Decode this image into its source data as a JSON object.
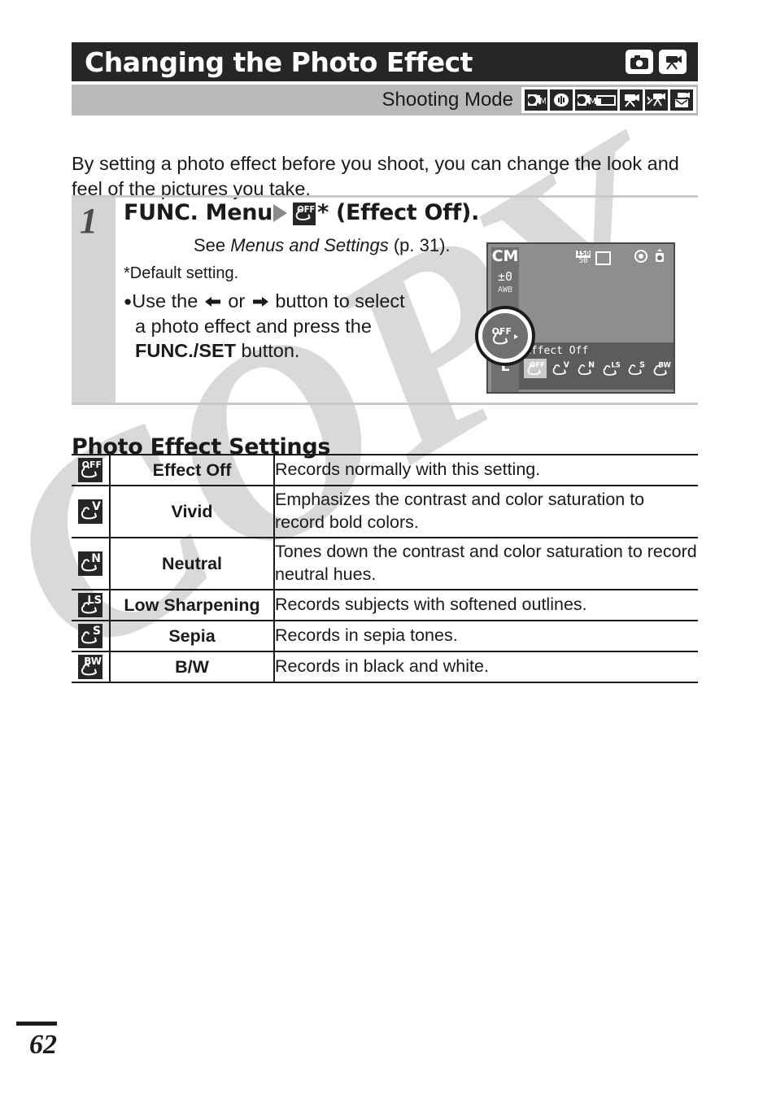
{
  "header": {
    "title": "Changing the Photo Effect",
    "title_icons": [
      "still-camera-icon",
      "movie-camera-icon"
    ],
    "mode_label": "Shooting Mode",
    "mode_icons": [
      "creative-manual-icon",
      "stitch-assist-icon",
      "manual-wide-icon",
      "movie-standard-icon",
      "movie-fast-frame-icon",
      "movie-compact-icon"
    ]
  },
  "intro": "By setting a photo effect before you shoot, you can change the look and feel of the pictures you take.",
  "step": {
    "number": "1",
    "heading_pre": "FUNC. Menu",
    "heading_post": "* (Effect Off).",
    "see_prefix": "See ",
    "see_italic": "Menus and Settings",
    "see_suffix": " (p. 31).",
    "default_note": "*Default setting.",
    "bullet_1": "Use the",
    "bullet_or": "or",
    "bullet_2": "button to select",
    "bullet_3": "a photo effect and press the",
    "bullet_bold": "FUNC./SET",
    "bullet_4": " button."
  },
  "lcd": {
    "mode": "CM",
    "exposure": "±0",
    "white_balance": "AWB",
    "image_size": "L",
    "iso_label": "ISO",
    "iso_value": "50",
    "effect_label": "Effect Off",
    "effects": [
      "OFF",
      "V",
      "N",
      "LS",
      "S",
      "BW"
    ],
    "selected_index": 0
  },
  "section_heading": "Photo Effect Settings",
  "table": {
    "rows": [
      {
        "icon": "effect-off-icon",
        "sup": "OFF",
        "name": "Effect Off",
        "desc": "Records normally with this setting.",
        "size": "short"
      },
      {
        "icon": "vivid-icon",
        "sup": "V",
        "name": "Vivid",
        "desc": "Emphasizes the contrast and color saturation to record bold colors.",
        "size": "tall"
      },
      {
        "icon": "neutral-icon",
        "sup": "N",
        "name": "Neutral",
        "desc": "Tones down the contrast and color saturation to record neutral hues.",
        "size": "tall"
      },
      {
        "icon": "low-sharpening-icon",
        "sup": "LS",
        "name": "Low Sharpening",
        "desc": "Records subjects with softened outlines.",
        "size": "short"
      },
      {
        "icon": "sepia-icon",
        "sup": "S",
        "name": "Sepia",
        "desc": "Records in sepia tones.",
        "size": "short"
      },
      {
        "icon": "bw-icon",
        "sup": "BW",
        "name": "B/W",
        "desc": "Records in black and white.",
        "size": "short"
      }
    ]
  },
  "footer": {
    "page_number": "62"
  },
  "watermark": {
    "text": "COPY",
    "color": "#d9d9d9"
  }
}
